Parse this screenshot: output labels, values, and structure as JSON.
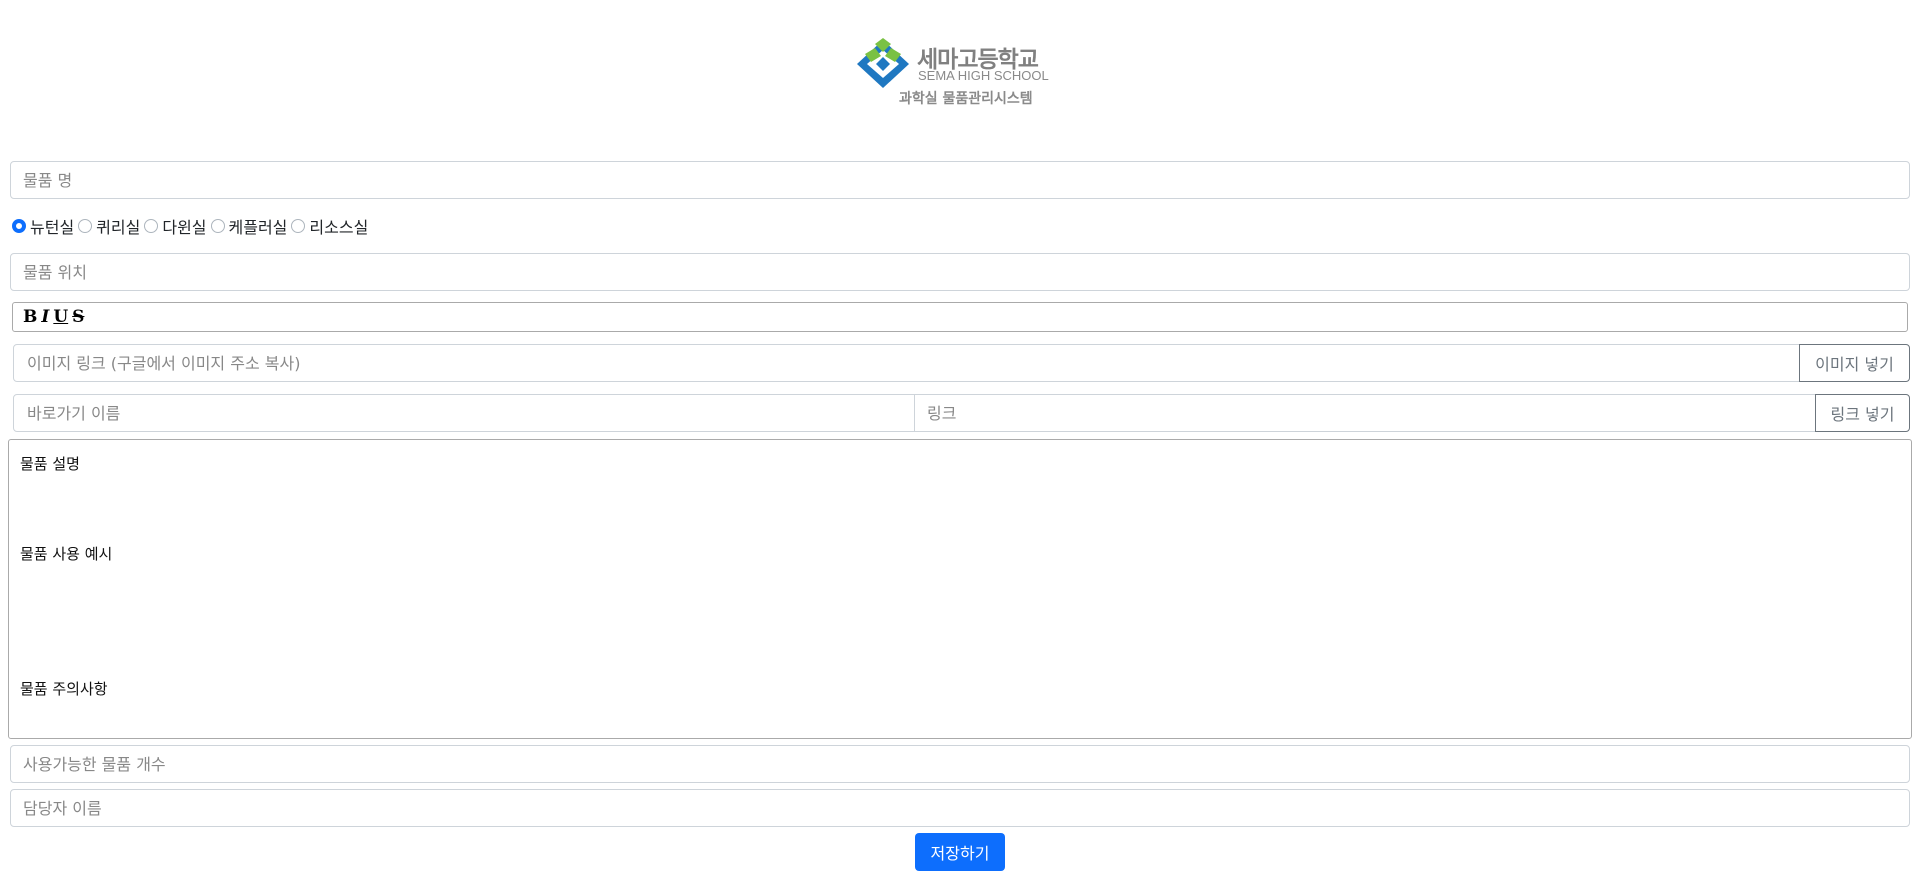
{
  "header": {
    "logo_korean": "세마고등학교",
    "logo_english": "SEMA HIGH SCHOOL",
    "subtitle": "과학실 물품관리시스템"
  },
  "form": {
    "item_name_placeholder": "물품 명",
    "rooms": [
      {
        "label": "뉴턴실",
        "checked": true
      },
      {
        "label": "퀴리실",
        "checked": false
      },
      {
        "label": "다윈실",
        "checked": false
      },
      {
        "label": "케플러실",
        "checked": false
      },
      {
        "label": "리소스실",
        "checked": false
      }
    ],
    "item_location_placeholder": "물품 위치",
    "toolbar": {
      "bold": "B",
      "italic": "I",
      "underline": "U",
      "strike": "S"
    },
    "image_link_placeholder": "이미지 링크 (구글에서 이미지 주소 복사)",
    "insert_image_label": "이미지 넣기",
    "shortcut_name_placeholder": "바로가기 이름",
    "link_placeholder": "링크",
    "insert_link_label": "링크 넣기",
    "description": {
      "line1": "물품 설명",
      "line2": "물품 사용 예시",
      "line3": "물품 주의사항"
    },
    "available_count_placeholder": "사용가능한 물품 개수",
    "manager_name_placeholder": "담당자 이름",
    "save_label": "저장하기"
  },
  "colors": {
    "accent": "#0d6efd",
    "logo_blue": "#1f78c1",
    "logo_green": "#7ac143"
  }
}
